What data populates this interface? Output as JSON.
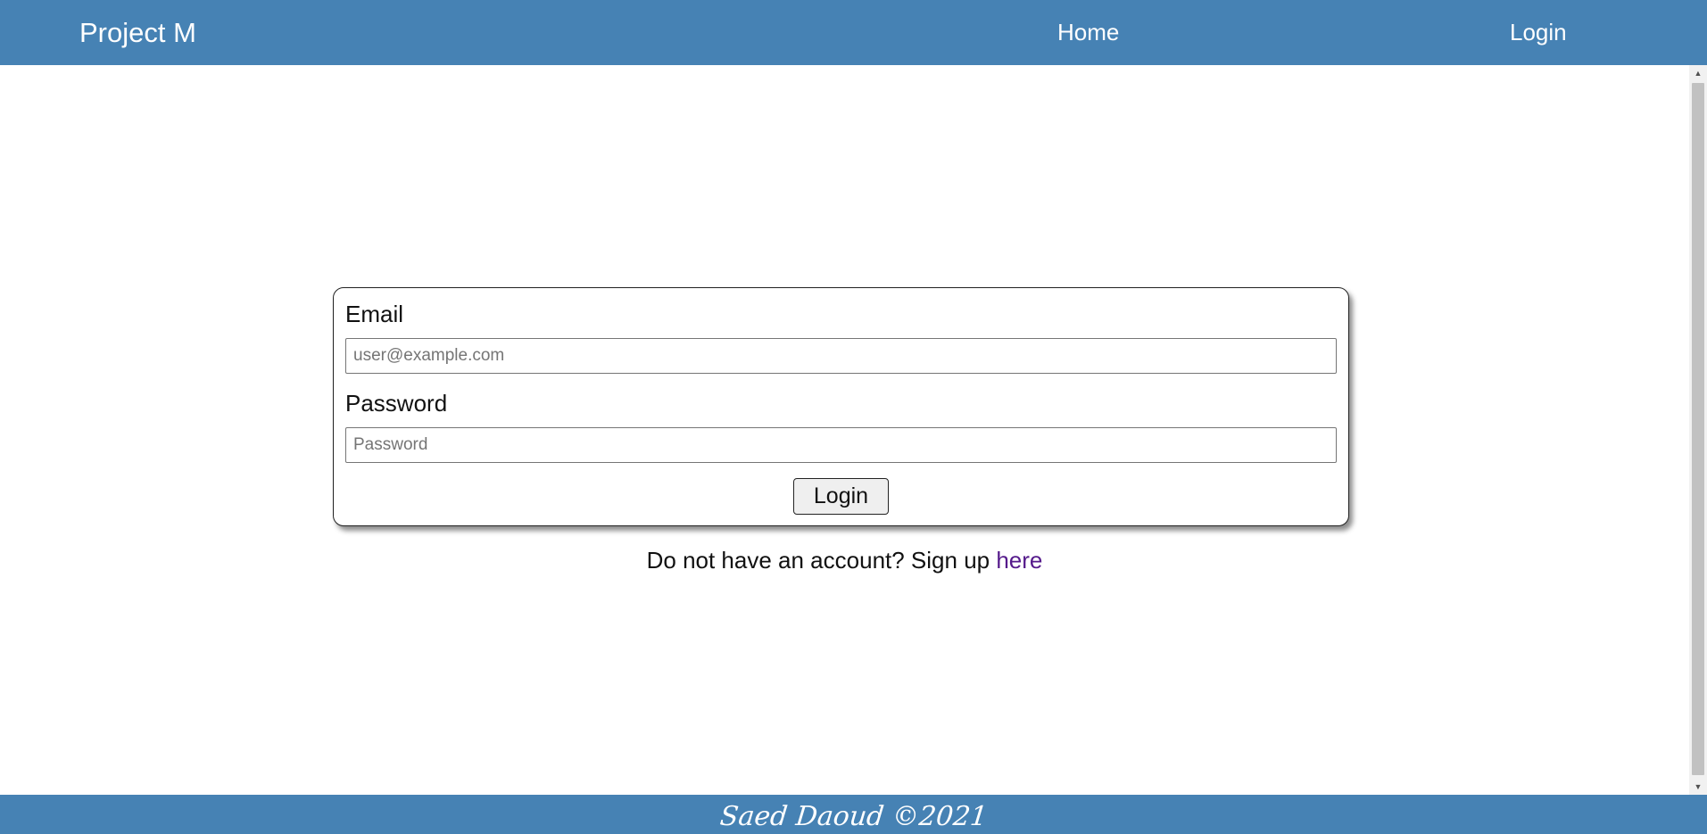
{
  "navbar": {
    "brand": "Project M",
    "links": [
      {
        "label": "Home"
      },
      {
        "label": "Login"
      }
    ],
    "background_color": "#4682b4"
  },
  "login_form": {
    "email_label": "Email",
    "email_placeholder": "user@example.com",
    "email_value": "",
    "password_label": "Password",
    "password_placeholder": "Password",
    "password_value": "",
    "submit_label": "Login"
  },
  "signup": {
    "prompt": "Do not have an account? Sign up ",
    "link_label": "here",
    "link_color": "#551a8b"
  },
  "footer": {
    "text": "Saed Daoud ©2021"
  },
  "scrollbar": {
    "up_icon": "chevron-up-icon",
    "down_icon": "chevron-down-icon"
  }
}
